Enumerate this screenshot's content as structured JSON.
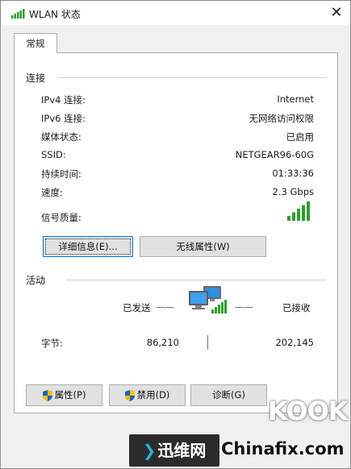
{
  "window": {
    "title": "WLAN 状态",
    "close_glyph": "✕"
  },
  "tabs": [
    {
      "label": "常规"
    }
  ],
  "connection": {
    "heading": "连接",
    "rows": [
      {
        "label": "IPv4 连接:",
        "value": "Internet"
      },
      {
        "label": "IPv6 连接:",
        "value": "无网络访问权限"
      },
      {
        "label": "媒体状态:",
        "value": "已启用"
      },
      {
        "label": "SSID:",
        "value": "NETGEAR96-60G"
      },
      {
        "label": "持续时间:",
        "value": "01:33:36"
      },
      {
        "label": "速度:",
        "value": "2.3 Gbps"
      }
    ],
    "signal_label": "信号质量:",
    "signal_bars": 5,
    "signal_max": 5,
    "details_button": "详细信息(E)...",
    "wireless_props_button": "无线属性(W)"
  },
  "activity": {
    "heading": "活动",
    "sent_label": "已发送",
    "received_label": "已接收",
    "dash": "——",
    "bytes_label": "字节:",
    "bytes_sent": "86,210",
    "bytes_received": "202,145"
  },
  "buttons": {
    "properties": "属性(P)",
    "disable": "禁用(D)",
    "diagnose": "诊断(G)"
  },
  "watermark": {
    "kook": "KOOK",
    "site_cn": "迅维网",
    "site_en": "Chinafix.com"
  },
  "colors": {
    "signal_green": "#2e9e2e",
    "shield_blue": "#1f5fbf",
    "shield_yellow": "#f2c200"
  }
}
